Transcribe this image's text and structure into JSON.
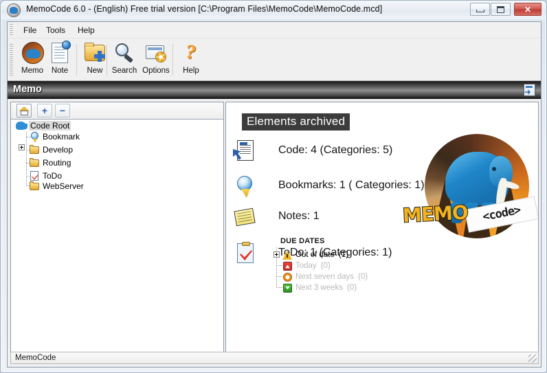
{
  "window": {
    "title": "MemoCode 6.0 - (English) Free trial version  [C:\\Program Files\\MemoCode\\MemoCode.mcd]",
    "icon": "memocode-elephant-icon",
    "minimize_label": "",
    "maximize_label": "",
    "close_label": "✕"
  },
  "menubar": {
    "items": [
      {
        "label": "File"
      },
      {
        "label": "Tools"
      },
      {
        "label": "Help"
      }
    ]
  },
  "toolbar": {
    "buttons": [
      {
        "label": "Memo",
        "icon": "memo-elephant-icon"
      },
      {
        "label": "Note",
        "icon": "note-page-icon"
      },
      {
        "label": "New",
        "icon": "new-folder-plus-icon"
      },
      {
        "label": "Search",
        "icon": "magnifier-icon"
      },
      {
        "label": "Options",
        "icon": "options-gear-icon"
      },
      {
        "label": "Help",
        "icon": "question-mark-icon"
      }
    ]
  },
  "section_header": {
    "title": "Memo",
    "right_icon": "export-document-icon"
  },
  "tree_panel": {
    "toolbar": {
      "home_label": "",
      "expand_label": "+",
      "collapse_label": "−"
    },
    "nodes": [
      {
        "label": "Code Root",
        "icon": "elephant-icon",
        "selected": true,
        "expandable": false
      },
      {
        "label": "Bookmark",
        "icon": "bookmark-icon",
        "selected": false,
        "expandable": false
      },
      {
        "label": "Develop",
        "icon": "folder-icon",
        "selected": false,
        "expandable": true
      },
      {
        "label": "Routing",
        "icon": "folder-icon",
        "selected": false,
        "expandable": false
      },
      {
        "label": "ToDo",
        "icon": "todo-check-icon",
        "selected": false,
        "expandable": false
      },
      {
        "label": "WebServer",
        "icon": "folder-icon",
        "selected": false,
        "expandable": false
      }
    ]
  },
  "content": {
    "title": "Elements archived",
    "stats": [
      {
        "icon": "code-document-icon",
        "text": "Code: 4 (Categories: 5)"
      },
      {
        "icon": "bookmark-rosette-icon",
        "text": "Bookmarks: 1 ( Categories: 1)"
      },
      {
        "icon": "sticky-note-icon",
        "text": "Notes: 1"
      },
      {
        "icon": "clipboard-check-icon",
        "text": "ToDo: 1 (Categories: 1)"
      }
    ],
    "due_dates": {
      "heading": "DUE DATES",
      "items": [
        {
          "label": "Out of date",
          "count": "(1)",
          "icon": "warning-triangle-icon",
          "expandable": true,
          "dimmed": false
        },
        {
          "label": "Today",
          "count": "(0)",
          "icon": "red-up-arrow-icon",
          "expandable": false,
          "dimmed": true
        },
        {
          "label": "Next seven days",
          "count": "(0)",
          "icon": "orange-circle-icon",
          "expandable": false,
          "dimmed": true
        },
        {
          "label": "Next 3 weeks",
          "count": "(0)",
          "icon": "green-down-arrow-icon",
          "expandable": false,
          "dimmed": true
        }
      ]
    },
    "logo": {
      "wordmark": "MEMO",
      "banner_text": "<code>",
      "alt": "memocode-elephant-logo"
    }
  },
  "statusbar": {
    "text": "MemoCode"
  },
  "colors": {
    "accent_blue": "#2f8fd4",
    "logo_orange": "#f2b31c",
    "header_dark": "#3c3c3c",
    "close_red": "#c2493f"
  }
}
